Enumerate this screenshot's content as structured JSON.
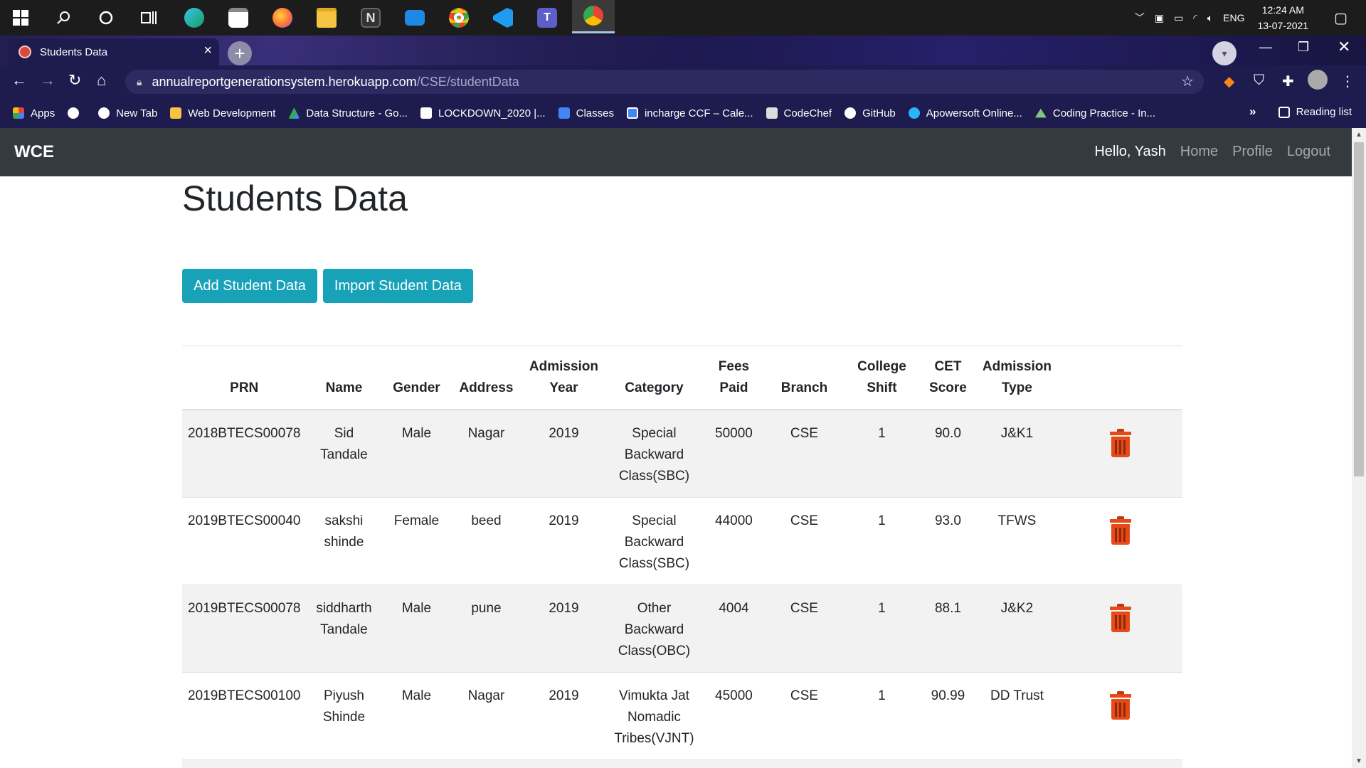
{
  "taskbar": {
    "icons": [
      "windows-start-icon",
      "search-icon",
      "cortana-icon",
      "task-view-icon",
      "edge-icon",
      "store-icon",
      "firefox-icon",
      "file-explorer-icon",
      "notion-icon",
      "mail-icon",
      "chrome-icon",
      "vscode-icon",
      "teams-icon",
      "chrome-profile-icon"
    ],
    "language": "ENG",
    "time": "12:24 AM",
    "date": "13-07-2021"
  },
  "browser": {
    "tab_title": "Students Data",
    "url_host": "annualreportgenerationsystem.herokuapp.com",
    "url_path": "/CSE/studentData",
    "bookmarks": [
      "Apps",
      "New Tab",
      "Web Development",
      "Data Structure - Go...",
      "LOCKDOWN_2020 |...",
      "Classes",
      "incharge CCF – Cale...",
      "CodeChef",
      "GitHub",
      "Apowersoft Online...",
      "Coding Practice - In..."
    ],
    "bookmark_more": "»",
    "reading_list": "Reading list"
  },
  "navbar": {
    "brand": "WCE",
    "greeting": "Hello, Yash",
    "links": [
      "Home",
      "Profile",
      "Logout"
    ]
  },
  "page": {
    "title": "Students Data",
    "add_button": "Add Student Data",
    "import_button": "Import Student Data"
  },
  "table": {
    "headers": [
      "PRN",
      "Name",
      "Gender",
      "Address",
      "Admission Year",
      "Category",
      "Fees Paid",
      "Branch",
      "College Shift",
      "CET Score",
      "Admission Type",
      ""
    ],
    "rows": [
      {
        "prn": "2018BTECS00078",
        "name": "Sid Tandale",
        "gender": "Male",
        "address": "Nagar",
        "year": "2019",
        "category": "Special Backward Class(SBC)",
        "fees": "50000",
        "branch": "CSE",
        "shift": "1",
        "cet": "90.0",
        "admission_type": "J&K1"
      },
      {
        "prn": "2019BTECS00040",
        "name": "sakshi shinde",
        "gender": "Female",
        "address": "beed",
        "year": "2019",
        "category": "Special Backward Class(SBC)",
        "fees": "44000",
        "branch": "CSE",
        "shift": "1",
        "cet": "93.0",
        "admission_type": "TFWS"
      },
      {
        "prn": "2019BTECS00078",
        "name": "siddharth Tandale",
        "gender": "Male",
        "address": "pune",
        "year": "2019",
        "category": "Other Backward Class(OBC)",
        "fees": "4004",
        "branch": "CSE",
        "shift": "1",
        "cet": "88.1",
        "admission_type": "J&K2"
      },
      {
        "prn": "2019BTECS00100",
        "name": "Piyush Shinde",
        "gender": "Male",
        "address": "Nagar",
        "year": "2019",
        "category": "Vimukta Jat Nomadic Tribes(VJNT)",
        "fees": "45000",
        "branch": "CSE",
        "shift": "1",
        "cet": "90.99",
        "admission_type": "DD Trust"
      }
    ]
  },
  "colors": {
    "accent": "#17a2b8",
    "navbar": "#343a40",
    "delete": "#e64a19"
  }
}
